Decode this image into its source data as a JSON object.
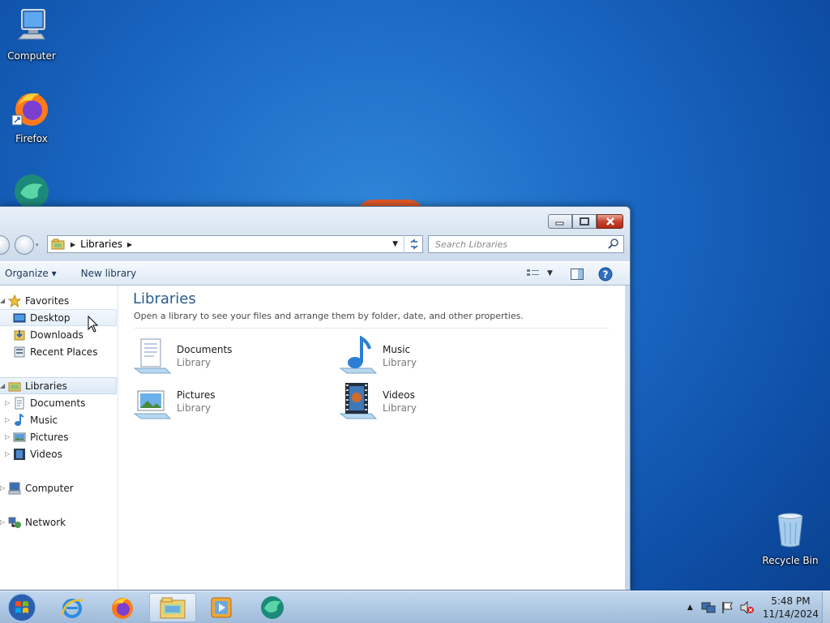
{
  "desktop": {
    "icons": [
      {
        "label": "Computer",
        "icon": "computer-icon"
      },
      {
        "label": "Firefox",
        "icon": "firefox-icon"
      },
      {
        "label": "",
        "icon": "app-icon"
      },
      {
        "label": "Recycle Bin",
        "icon": "recycle-bin-icon"
      }
    ]
  },
  "window": {
    "breadcrumb": "Libraries",
    "search_placeholder": "Search Libraries",
    "toolbar": {
      "organize": "Organize ▾",
      "new_library": "New library"
    },
    "nav": {
      "favorites": "Favorites",
      "desktop": "Desktop",
      "downloads": "Downloads",
      "recent": "Recent Places",
      "libraries": "Libraries",
      "documents": "Documents",
      "music": "Music",
      "pictures": "Pictures",
      "videos": "Videos",
      "computer": "Computer",
      "network": "Network"
    },
    "main": {
      "title": "Libraries",
      "subtitle": "Open a library to see your files and arrange them by folder, date, and other properties.",
      "items": [
        {
          "name": "Documents",
          "type": "Library"
        },
        {
          "name": "Music",
          "type": "Library"
        },
        {
          "name": "Pictures",
          "type": "Library"
        },
        {
          "name": "Videos",
          "type": "Library"
        }
      ]
    }
  },
  "taskbar": {
    "time": "5:48 PM",
    "date": "11/14/2024"
  },
  "colors": {
    "accent": "#1a68c4",
    "title": "#2a5c8d"
  }
}
